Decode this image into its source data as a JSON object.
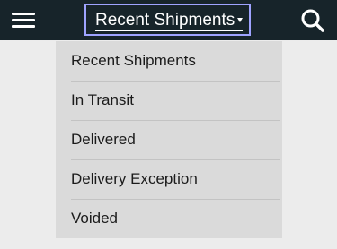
{
  "header": {
    "title": "Recent Shipments",
    "menu_icon": "hamburger-menu-icon",
    "search_icon": "search-icon",
    "background_color": "#17242a",
    "focus_color": "#9fa3ff"
  },
  "dropdown": {
    "items": [
      {
        "label": "Recent Shipments"
      },
      {
        "label": "In Transit"
      },
      {
        "label": "Delivered"
      },
      {
        "label": "Delivery Exception"
      },
      {
        "label": "Voided"
      }
    ]
  }
}
